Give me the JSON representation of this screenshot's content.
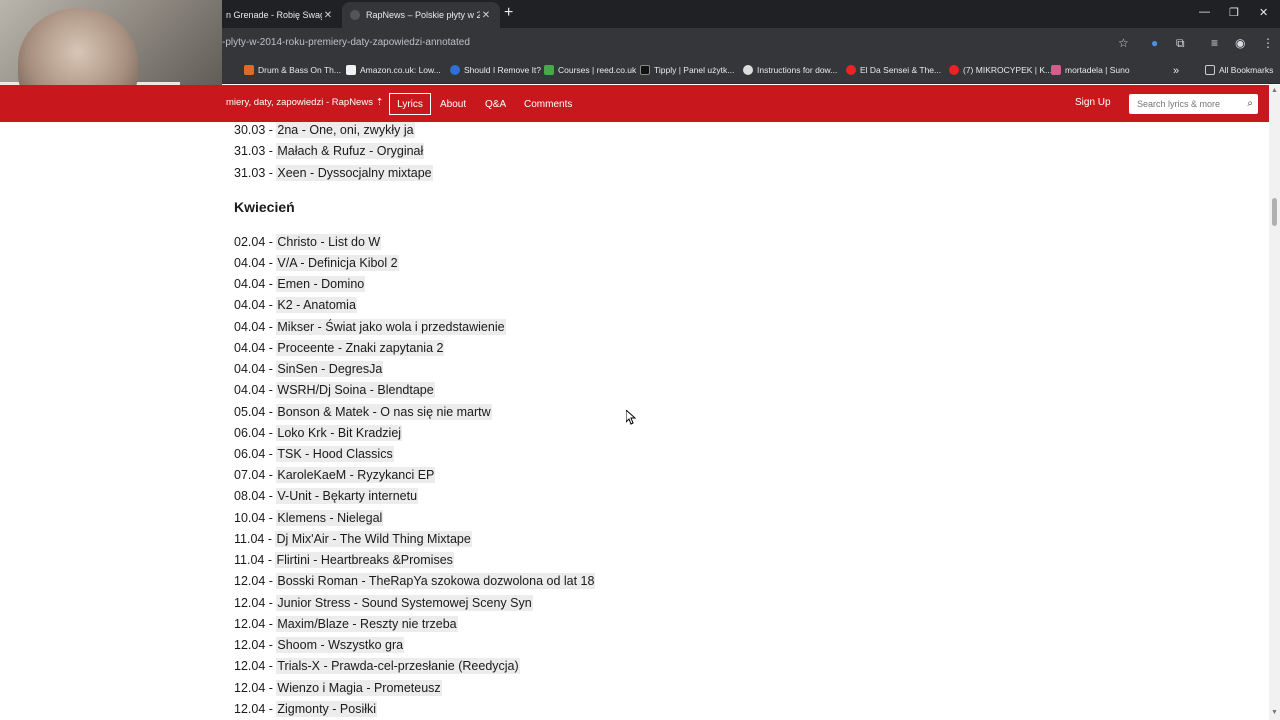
{
  "browser": {
    "tabs": [
      {
        "title": "n Grenade - Robię Swag (p",
        "active": false
      },
      {
        "title": "RapNews – Polskie płyty w 2014",
        "active": true
      }
    ],
    "url": "-plyty-w-2014-roku-premiery-daty-zapowiedzi-annotated",
    "bookmarks": [
      "Drum & Bass On Th...",
      "Amazon.co.uk: Low...",
      "Should I Remove It?",
      "Courses | reed.co.uk",
      "Tipply | Panel użytk...",
      "Instructions for dow...",
      "El Da Sensei & The...",
      "(7) MIKROCYPEK | K...",
      "mortadela | Suno"
    ],
    "all_bookmarks": "All Bookmarks"
  },
  "header": {
    "page_title": "miery, daty, zapowiedzi - RapNews",
    "nav": [
      "Lyrics",
      "About",
      "Q&A",
      "Comments"
    ],
    "signup": "Sign Up",
    "search_placeholder": "Search lyrics & more"
  },
  "content": {
    "lines_top": [
      {
        "date": "30.03 - ",
        "text": "2na - One, oni, zwykły ja"
      },
      {
        "date": "31.03 - ",
        "text": "Małach & Rufuz - Oryginał"
      },
      {
        "date": "31.03 - ",
        "text": "Xeen - Dyssocjalny mixtape"
      }
    ],
    "heading": "Kwiecień",
    "lines": [
      {
        "date": "02.04 - ",
        "text": "Christo - List do W"
      },
      {
        "date": "04.04 - ",
        "text": "V/A - Definicja Kibol 2"
      },
      {
        "date": "04.04 - ",
        "text": "Emen - Domino"
      },
      {
        "date": "04.04 - ",
        "text": "K2 - Anatomia"
      },
      {
        "date": "04.04 - ",
        "text": "Mikser - Świat jako wola i przedstawienie"
      },
      {
        "date": "04.04 - ",
        "text": "Proceente - Znaki zapytania 2"
      },
      {
        "date": "04.04 - ",
        "text": "SinSen - DegresJa"
      },
      {
        "date": "04.04 - ",
        "text": "WSRH/Dj Soina - Blendtape"
      },
      {
        "date": "05.04 - ",
        "text": "Bonson & Matek - O nas się nie martw"
      },
      {
        "date": "06.04 - ",
        "text": "Loko Krk - Bit Kradziej"
      },
      {
        "date": "06.04 - ",
        "text": "TSK - Hood Classics"
      },
      {
        "date": "07.04 - ",
        "text": "KaroleKaeM - Ryzykanci EP"
      },
      {
        "date": "08.04 - ",
        "text": "V-Unit - Bękarty internetu"
      },
      {
        "date": "10.04 - ",
        "text": "Klemens - Nielegal"
      },
      {
        "date": "11.04 - ",
        "text": "Dj Mix'Air - The Wild Thing Mixtape"
      },
      {
        "date": "11.04 - ",
        "text": "Flirtini - Heartbreaks &Promises"
      },
      {
        "date": "12.04 - ",
        "text": "Bosski Roman - TheRapYa szokowa dozwolona od lat 18"
      },
      {
        "date": "12.04 - ",
        "text": "Junior Stress - Sound Systemowej Sceny Syn"
      },
      {
        "date": "12.04 - ",
        "text": "Maxim/Blaze - Reszty nie trzeba"
      },
      {
        "date": "12.04 - ",
        "text": "Shoom - Wszystko gra"
      },
      {
        "date": "12.04 - ",
        "text": "Trials-X - Prawda-cel-przesłanie (Reedycja)"
      },
      {
        "date": "12.04 - ",
        "text": "Wienzo i Magia - Prometeusz"
      },
      {
        "date": "12.04 - ",
        "text": "Zigmonty - Posiłki"
      }
    ]
  },
  "colors": {
    "brand": "#c8181e",
    "chrome_dark": "#202124",
    "chrome_mid": "#35363a",
    "annotation_bg": "#ececec"
  }
}
